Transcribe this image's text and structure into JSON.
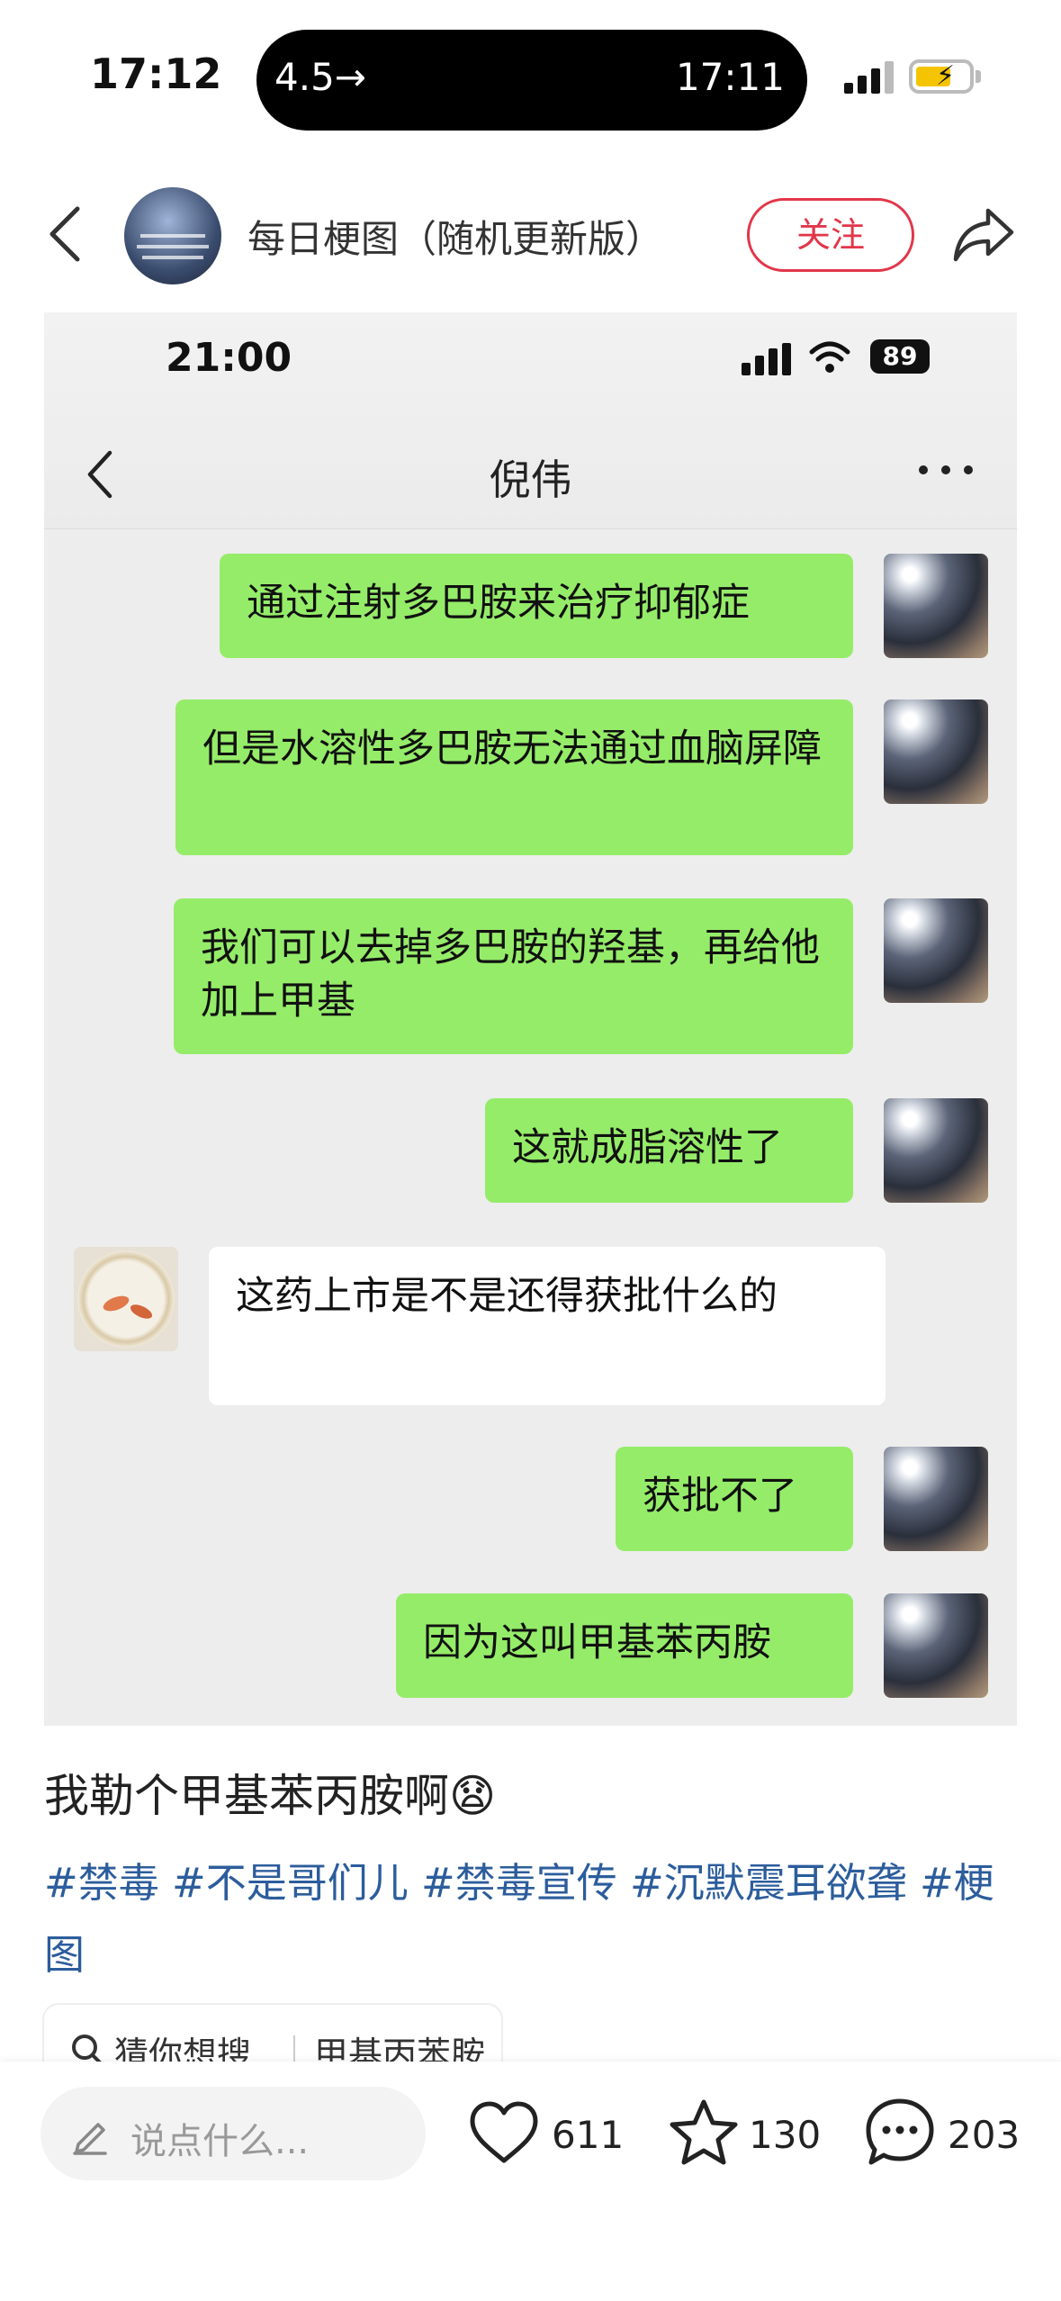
{
  "status_bar": {
    "time": "17:12",
    "island_left": "4.5→",
    "island_right": "17:11"
  },
  "post_header": {
    "author": "每日梗图（随机更新版）",
    "follow_label": "关注"
  },
  "embedded_chat": {
    "status_time": "21:00",
    "battery": "89",
    "contact_name": "倪伟",
    "messages": [
      {
        "from": "me",
        "text": "通过注射多巴胺来治疗抑郁症"
      },
      {
        "from": "me",
        "text": "但是水溶性多巴胺无法通过血脑屏障"
      },
      {
        "from": "me",
        "text": "我们可以去掉多巴胺的羟基，再给他加上甲基"
      },
      {
        "from": "me",
        "text": "这就成脂溶性了"
      },
      {
        "from": "them",
        "text": "这药上市是不是还得获批什么的"
      },
      {
        "from": "me",
        "text": "获批不了"
      },
      {
        "from": "me",
        "text": "因为这叫甲基苯丙胺"
      }
    ]
  },
  "caption": {
    "title": "我勒个甲基苯丙胺啊😧",
    "tags": "#禁毒 #不是哥们儿 #禁毒宣传 #沉默震耳欲聋 #梗图"
  },
  "guess_search": {
    "label": "猜你想搜",
    "query": "甲基丙苯胺"
  },
  "bottom_bar": {
    "input_placeholder": "说点什么...",
    "likes": "611",
    "collects": "130",
    "comments": "203"
  }
}
